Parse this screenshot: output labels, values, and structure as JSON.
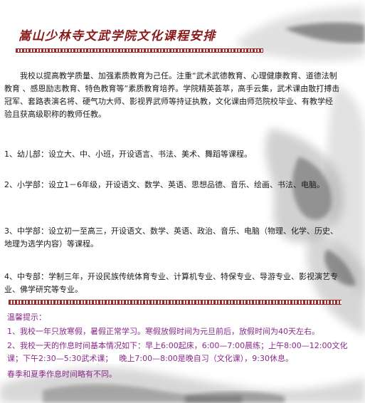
{
  "page": {
    "title": "嵩山少林寺文武学院文化课程安排",
    "intro": "我校以提高教学质量、加强素质教育为己任。注重“武术武德教育、心理健康教育、道德法制教育 、感恩励志教育、特色教育等”素质教育培养。学院精英荟萃，高手云集，武术课由散打搏击冠军、套路表演名将、硬气功大师、影视界武师等持证执教，文化课由师范院校毕业、有教学经验且获高级职称的教师任教。",
    "sections": [
      "1、幼儿部：设立大、中、小班，开设语言、书法、美术、舞蹈等课程。",
      "2、小学部：设立1－6年级，开设语文、数学、英语、思想品德、音乐、绘画、书法、电脑。",
      "3、中学部：设立初一至高三，开设语文、数学、英语、政治、音乐、电脑（物理、化学、历史、地理为选学内容）等课程。",
      "4、中专部：学制三年，开设民族传统体育专业、计算机专业、特保专业、导游专业、影视演艺专业、佛学研究等专业。"
    ],
    "tips": {
      "heading": "温馨提示：",
      "item1": "1、我校一年只放寒假，暑假正常学习。寒假放假时间为元旦前后，放假时间为40天左右。",
      "item2": "2、我校一天的作息时间基本情况如下：早上6:00起床，6:00—7:00晨练；上午8:00—12:00文化课；下午2:30—5:30武术课；　 晚上7:00—8:00是晚自习（文化课），9:30休息。",
      "item3": "春季和夏季作息时间略有不同。"
    }
  },
  "colors": {
    "title": "#8a1a1a",
    "body_text": "#1a1a1a",
    "tips": "#8a2a8a",
    "border": "#9a2e2e"
  }
}
